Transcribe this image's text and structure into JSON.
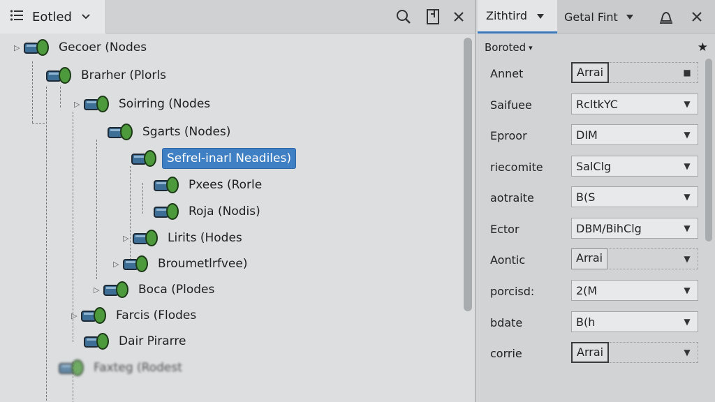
{
  "left_panel": {
    "tab_title": "Eotled",
    "icons": [
      "list-icon",
      "chevron-down-icon",
      "search-icon",
      "panel-icon",
      "close-icon"
    ]
  },
  "tree": [
    {
      "label": "Gecoer (Nodes",
      "depth": 0,
      "twisty": "▷"
    },
    {
      "label": "Brarher (Plorls",
      "depth": 1,
      "twisty": ""
    },
    {
      "label": "Soirring (Nodes",
      "depth": 2,
      "twisty": "▷"
    },
    {
      "label": "Sgarts (Nodes)",
      "depth": 3,
      "twisty": ""
    },
    {
      "label": "Sefrel-inarl Neadiles)",
      "depth": 4,
      "twisty": "",
      "selected": true
    },
    {
      "label": "Pxees (Rorle",
      "depth": 5,
      "twisty": ""
    },
    {
      "label": "Roja (Nodis)",
      "depth": 5,
      "twisty": ""
    },
    {
      "label": "Lirits (Hodes",
      "depth": 4,
      "twisty": "▷"
    },
    {
      "label": "Broumetlrfvee)",
      "depth": 3,
      "twisty": "▷"
    },
    {
      "label": "Boca (Plodes",
      "depth": 2,
      "twisty": "▷"
    },
    {
      "label": "Farcis (Flodes",
      "depth": 1,
      "twisty": "▷"
    },
    {
      "label": "Dair Pirarre",
      "depth": 1,
      "twisty": ""
    },
    {
      "label": "Faxteg (Rodest",
      "depth": 0,
      "twisty": "",
      "faded": true
    }
  ],
  "right_panel": {
    "tab1": "Zithtird",
    "tab2": "Getal Fint",
    "section_title": "Boroted",
    "properties": [
      {
        "label": "Annet",
        "value": "Arrai",
        "kind": "array"
      },
      {
        "label": "Saifuee",
        "value": "RcltkYC",
        "kind": "select"
      },
      {
        "label": "Eproor",
        "value": "DIM",
        "kind": "select"
      },
      {
        "label": "riecomite",
        "value": "SalClg",
        "kind": "select"
      },
      {
        "label": "aotraite",
        "value": "B(S",
        "kind": "select"
      },
      {
        "label": "Ector",
        "value": "DBM/BihClg",
        "kind": "select"
      },
      {
        "label": "Aontic",
        "value": "Arrai",
        "kind": "array2"
      },
      {
        "label": "porcisd:",
        "value": "2(M",
        "kind": "select"
      },
      {
        "label": "bdate",
        "value": "B(h",
        "kind": "select"
      },
      {
        "label": "corrie",
        "value": "Arrai",
        "kind": "array"
      }
    ]
  }
}
